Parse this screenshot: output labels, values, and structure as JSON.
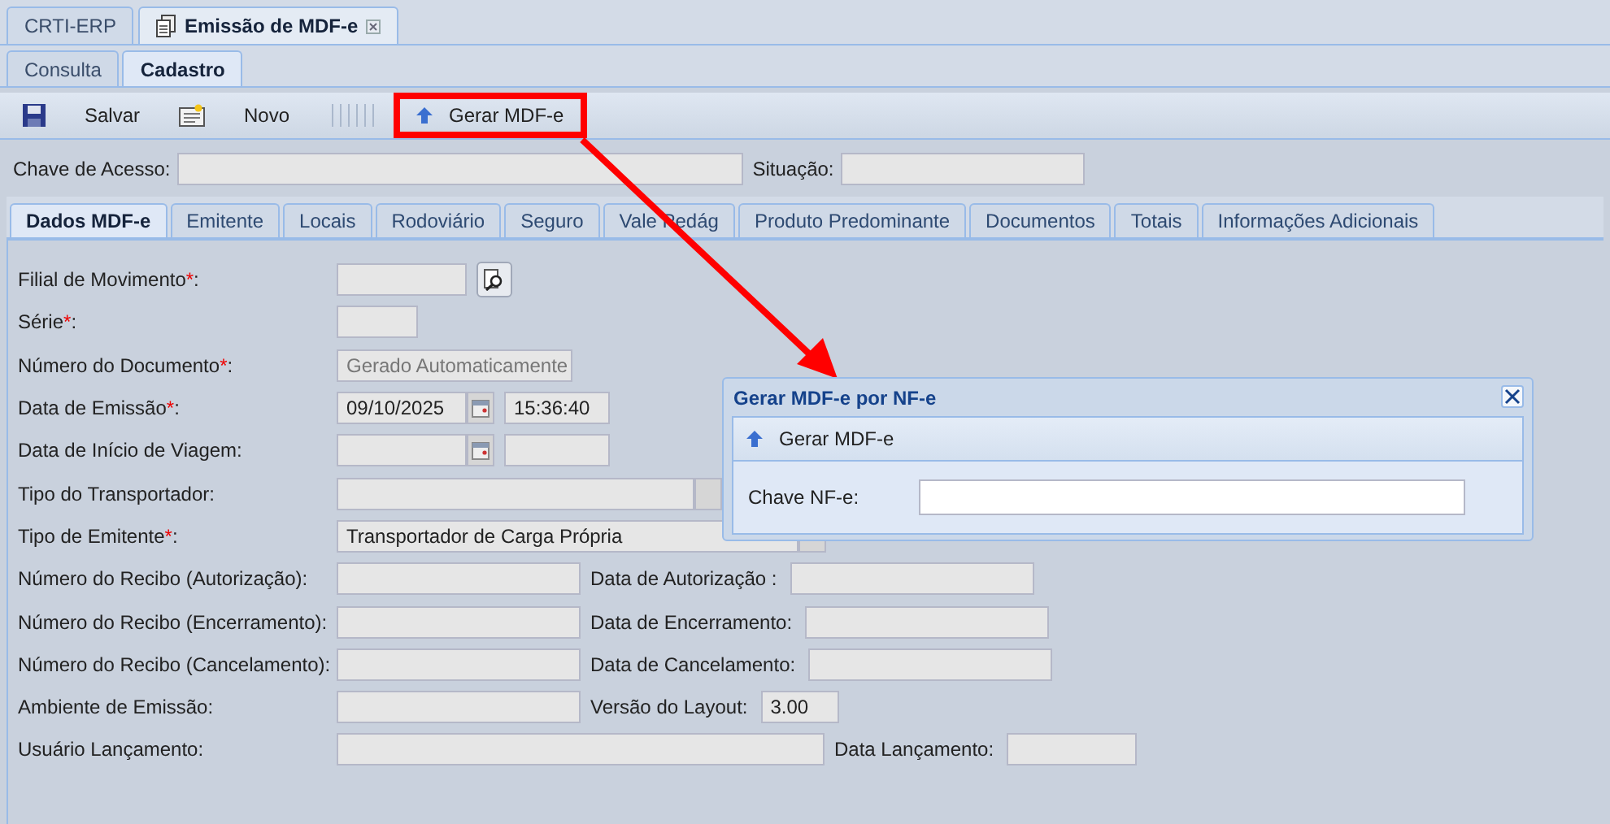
{
  "app_tabs": [
    {
      "label": "CRTI-ERP",
      "selected": false,
      "closable": false
    },
    {
      "label": "Emissão de MDF-e",
      "selected": true,
      "closable": true
    }
  ],
  "sub_tabs": [
    {
      "label": "Consulta",
      "selected": false
    },
    {
      "label": "Cadastro",
      "selected": true
    }
  ],
  "toolbar": [
    {
      "kind": "save",
      "label": "Salvar",
      "highlighted": false
    },
    {
      "kind": "new",
      "label": "Novo",
      "highlighted": false
    },
    {
      "kind": "generate",
      "label": "Gerar MDF-e",
      "highlighted": true
    }
  ],
  "header_fields": [
    {
      "label": "Chave de Acesso:"
    },
    {
      "label": "Situação:"
    }
  ],
  "form_tabs": [
    {
      "label": "Dados MDF-e",
      "selected": true
    },
    {
      "label": "Emitente",
      "selected": false
    },
    {
      "label": "Locais",
      "selected": false
    },
    {
      "label": "Rodoviário",
      "selected": false
    },
    {
      "label": "Seguro",
      "selected": false
    },
    {
      "label": "Vale Pedág",
      "selected": false
    },
    {
      "label": "Produto Predominante",
      "selected": false
    },
    {
      "label": "Documentos",
      "selected": false
    },
    {
      "label": "Totais",
      "selected": false
    },
    {
      "label": "Informações Adicionais",
      "selected": false
    }
  ],
  "form_rows": [
    {
      "label": "Filial de Movimento",
      "required_mark": "*",
      "label_end": ":",
      "fields": [
        {
          "kind": "lookup"
        }
      ]
    },
    {
      "label": "Série",
      "required_mark": "*",
      "label_end": ":",
      "fields": [
        {
          "kind": "text"
        }
      ]
    },
    {
      "label": "Número do Documento",
      "required_mark": "*",
      "label_end": ":",
      "fields": [
        {
          "kind": "text",
          "placeholder": "Gerado Automaticamente"
        }
      ]
    },
    {
      "label": "Data de Emissão",
      "required_mark": "*",
      "label_end": ":",
      "fields": [
        {
          "kind": "date",
          "value": "09/10/2025"
        },
        {
          "kind": "text",
          "value": "15:36:40"
        }
      ]
    },
    {
      "label": "Data de Início de Viagem:",
      "fields": [
        {
          "kind": "date"
        },
        {
          "kind": "text"
        }
      ]
    },
    {
      "label": "Tipo do Transportador:",
      "fields": [
        {
          "kind": "combo"
        }
      ]
    },
    {
      "label": "Tipo de Emitente",
      "required_mark": "*",
      "label_end": ":",
      "fields": [
        {
          "kind": "combo",
          "value": "Transportador de Carga Própria"
        }
      ]
    },
    {
      "label": "Número do Recibo (Autorização):",
      "fields": [
        {
          "kind": "text"
        }
      ],
      "secondary": {
        "label": "Data de Autorização :"
      }
    },
    {
      "label": "Número do Recibo (Encerramento):",
      "fields": [
        {
          "kind": "text"
        }
      ],
      "secondary": {
        "label": "Data de Encerramento:"
      }
    },
    {
      "label": "Número do Recibo (Cancelamento):",
      "fields": [
        {
          "kind": "text"
        }
      ],
      "secondary": {
        "label": "Data de Cancelamento:"
      }
    },
    {
      "label": "Ambiente de Emissão:",
      "fields": [
        {
          "kind": "text"
        }
      ],
      "secondary": {
        "label": "Versão do Layout:",
        "value": "3.00"
      }
    },
    {
      "label": "Usuário Lançamento:",
      "fields": [
        {
          "kind": "text"
        }
      ],
      "secondary": {
        "label": "Data Lançamento:"
      }
    }
  ],
  "dialog": {
    "title": "Gerar MDF-e por NF-e",
    "button": "Gerar MDF-e",
    "field_label": "Chave NF-e:"
  }
}
